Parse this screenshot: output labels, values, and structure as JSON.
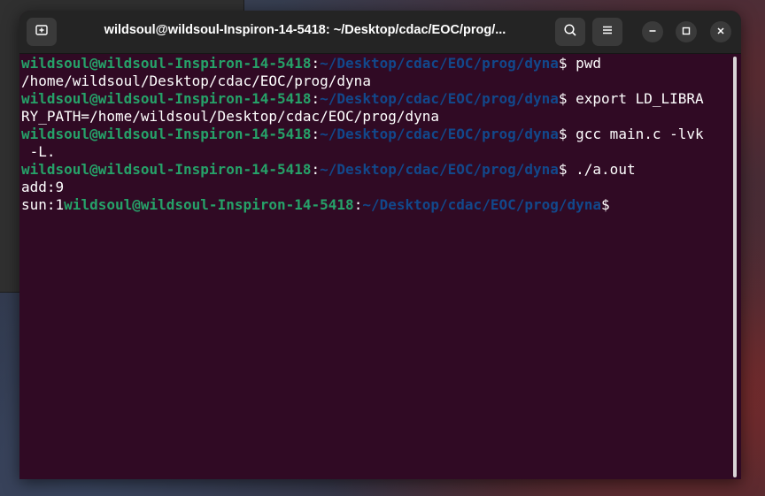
{
  "window": {
    "title": "wildsoul@wildsoul-Inspiron-14-5418: ~/Desktop/cdac/EOC/prog/..."
  },
  "icons": {
    "new_tab": "new-tab-icon",
    "search": "search-icon",
    "menu": "hamburger-menu-icon",
    "minimize": "minimize-icon",
    "maximize": "maximize-icon",
    "close": "close-icon"
  },
  "terminal": {
    "user_host": "wildsoul@wildsoul-Inspiron-14-5418",
    "colon": ":",
    "cwd": "~/Desktop/cdac/EOC/prog/dyna",
    "prompt_symbol": "$",
    "lines": [
      {
        "cmd": " pwd"
      },
      {
        "output": "/home/wildsoul/Desktop/cdac/EOC/prog/dyna"
      },
      {
        "cmd": " export LD_LIBRA"
      },
      {
        "output": "RY_PATH=/home/wildsoul/Desktop/cdac/EOC/prog/dyna"
      },
      {
        "cmd": " gcc main.c -lvk"
      },
      {
        "output": " -L."
      },
      {
        "cmd": " ./a.out"
      },
      {
        "output": "add:9"
      },
      {
        "output_prefix": "sun:1"
      }
    ]
  },
  "colors": {
    "terminal_bg": "#300a24",
    "prompt_user": "#26a269",
    "prompt_path": "#12488b",
    "headerbar_bg": "#242424"
  }
}
